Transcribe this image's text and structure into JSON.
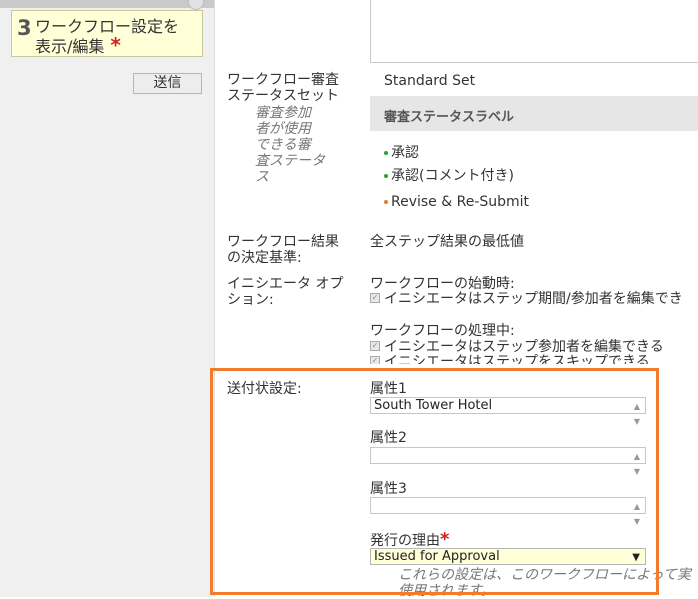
{
  "left": {
    "step_number": "3",
    "step_line1": "ワークフロー設定を",
    "step_line2": "表示/編集",
    "required_mark": "*",
    "send_button": "送信"
  },
  "review_status": {
    "label_line1": "ワークフロー審査",
    "label_line2": "ステータスセット",
    "sub_label": [
      "審査参加",
      "者が使用",
      "できる審",
      "査ステータ",
      "ス"
    ],
    "value": "Standard Set",
    "header": "審査ステータスラベル",
    "items": [
      {
        "label": "承認",
        "color": "#2ea12e"
      },
      {
        "label": "承認(コメント付き)",
        "color": "#2ea12e"
      },
      {
        "label": "Revise & Re-Submit",
        "color": "#e8792b"
      }
    ]
  },
  "criteria": {
    "label_line1": "ワークフロー結果",
    "label_line2": "の決定基準:",
    "value": "全ステップ結果の最低値"
  },
  "initiator": {
    "label_line1": "イニシエータ オプ",
    "label_line2": "ション:",
    "start_heading": "ワークフローの始動時:",
    "start_option": "イニシエータはステップ期間/参加者を編集でき",
    "progress_heading": "ワークフローの処理中:",
    "progress_option1": "イニシエータはステップ参加者を編集できる",
    "progress_option2": "イニシエータはステップをスキップできる"
  },
  "transmittal": {
    "label": "送付状設定:",
    "attr1_label": "属性1",
    "attr1_value": "South Tower Hotel",
    "attr2_label": "属性2",
    "attr2_value": "",
    "attr3_label": "属性3",
    "attr3_value": "",
    "reason_label": "発行の理由",
    "reason_required": "*",
    "reason_value": "Issued for Approval",
    "note_line1": "これらの設定は、このワークフローによって実",
    "note_line2": "使用されます。"
  },
  "colors": {
    "highlight_frame": "#f07c2c",
    "required": "#d02020",
    "step_box_bg": "#ffffd8"
  }
}
